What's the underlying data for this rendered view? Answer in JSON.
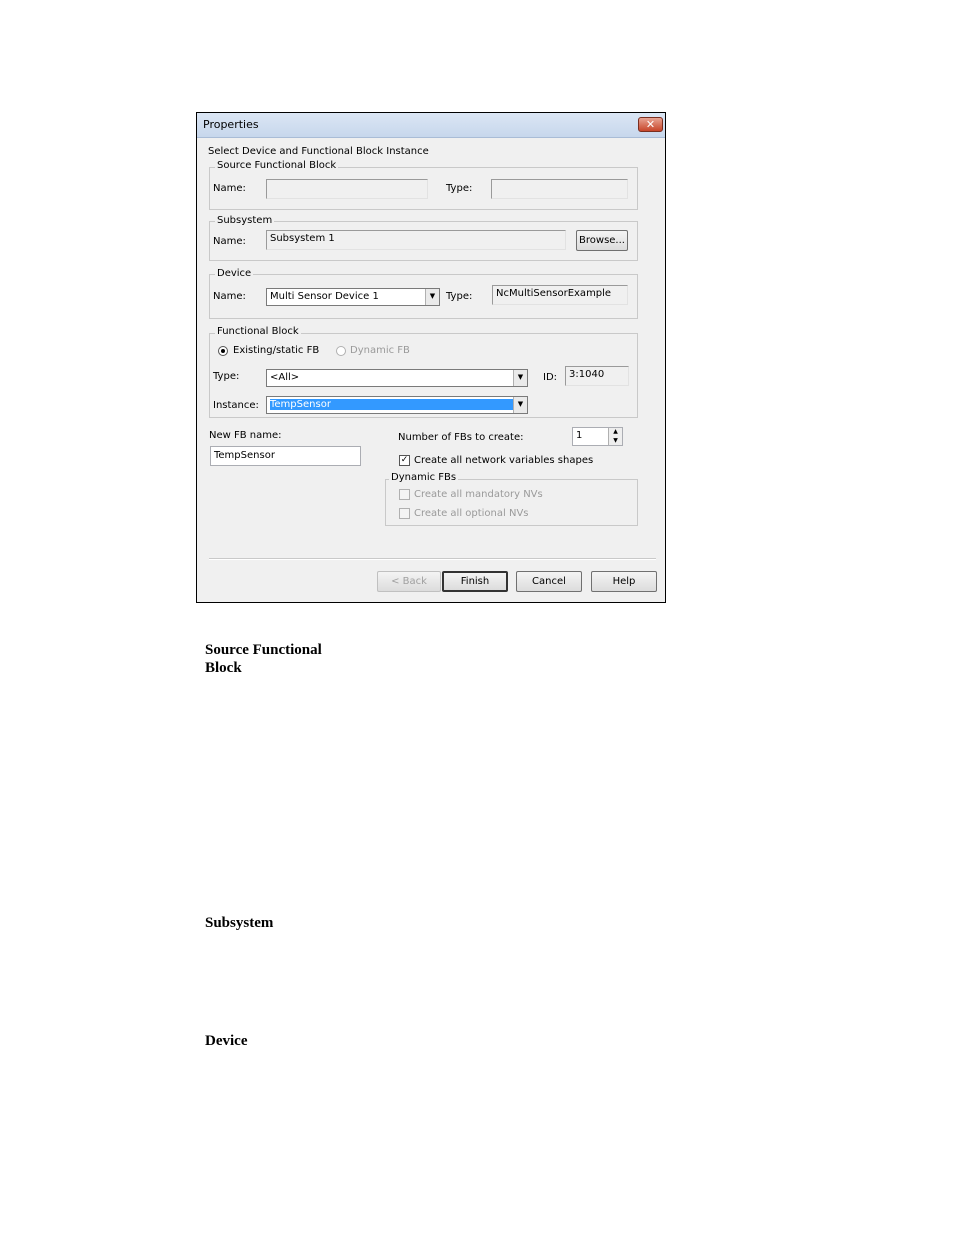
{
  "dialog": {
    "title": "Properties",
    "close_glyph": "✕",
    "instruction": "Select Device and Functional Block Instance",
    "source_fb": {
      "legend": "Source Functional Block",
      "name_label": "Name:",
      "name_value": "",
      "type_label": "Type:",
      "type_value": ""
    },
    "subsystem": {
      "legend": "Subsystem",
      "name_label": "Name:",
      "name_value": "Subsystem 1",
      "browse_label": "Browse..."
    },
    "device": {
      "legend": "Device",
      "name_label": "Name:",
      "name_value": "Multi Sensor Device 1",
      "type_label": "Type:",
      "type_value": "NcMultiSensorExample"
    },
    "functional_block": {
      "legend": "Functional Block",
      "radio_existing": "Existing/static FB",
      "radio_dynamic": "Dynamic FB",
      "type_label": "Type:",
      "type_value": "<All>",
      "id_label": "ID:",
      "id_value": "3:1040",
      "instance_label": "Instance:",
      "instance_value": "TempSensor"
    },
    "new_fb_name_label": "New FB name:",
    "new_fb_name_value": "TempSensor",
    "num_fbs_label": "Number of FBs to create:",
    "num_fbs_value": "1",
    "create_shapes_label": "Create all network variables shapes",
    "dynamic_fbs": {
      "legend": "Dynamic FBs",
      "mandatory_label": "Create all mandatory NVs",
      "optional_label": "Create all optional NVs"
    },
    "buttons": {
      "back": "< Back",
      "finish": "Finish",
      "cancel": "Cancel",
      "help": "Help"
    }
  },
  "doc_headings": {
    "source_fb_line1": "Source Functional",
    "source_fb_line2": "Block",
    "subsystem": "Subsystem",
    "device": "Device"
  }
}
